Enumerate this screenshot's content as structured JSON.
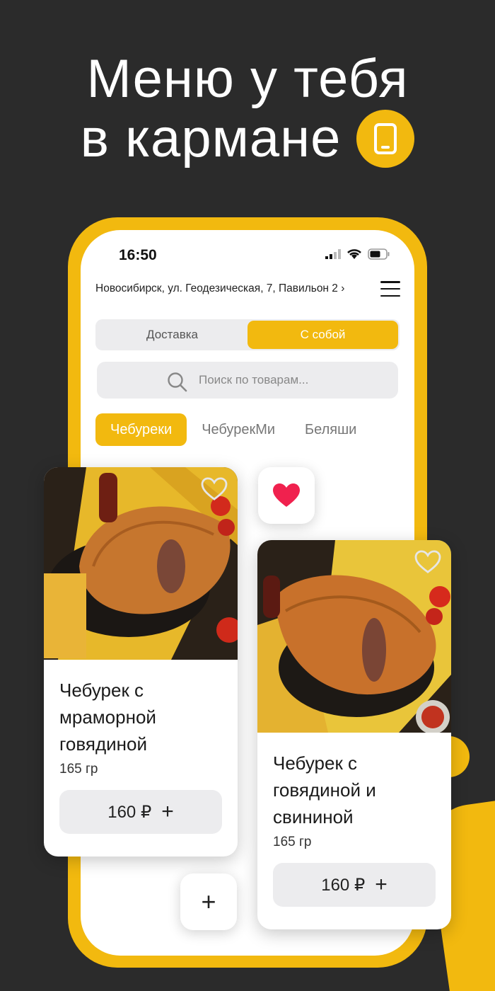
{
  "headline": {
    "line1": "Меню у тебя",
    "line2": "в кармане"
  },
  "status_bar": {
    "time": "16:50"
  },
  "address": "Новосибирск, ул. Геодезическая, 7, Павильон 2 ›",
  "order_modes": [
    {
      "label": "Доставка",
      "active": false
    },
    {
      "label": "С собой",
      "active": true
    }
  ],
  "search": {
    "placeholder": "Поиск по товарам..."
  },
  "categories": [
    {
      "label": "Чебуреки",
      "active": true
    },
    {
      "label": "ЧебурекМи",
      "active": false
    },
    {
      "label": "Беляши",
      "active": false
    }
  ],
  "products": [
    {
      "title": "Чебурек с мраморной говядиной",
      "weight": "165 гр",
      "price": "160 ₽",
      "favorite": false
    },
    {
      "title": "Чебурек с говядиной и свининой",
      "weight": "165 гр",
      "price": "160 ₽",
      "favorite": false
    }
  ],
  "colors": {
    "accent": "#f2b90f",
    "background": "#2b2b2b",
    "heart": "#f0214e"
  },
  "icons": [
    "phone-icon",
    "menu-icon",
    "search-icon",
    "heart-outline-icon",
    "heart-icon",
    "plus-icon"
  ]
}
